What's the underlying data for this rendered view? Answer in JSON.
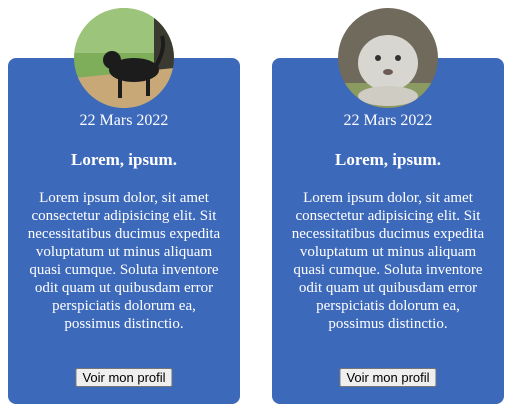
{
  "cards": [
    {
      "date": "22 Mars 2022",
      "title": "Lorem, ipsum.",
      "text": "Lorem ipsum dolor, sit amet consectetur adipisicing elit. Sit necessitatibus ducimus expedita voluptatum ut minus aliquam quasi cumque. Soluta inventore odit quam ut quibusdam error perspiciatis dolorum ea, possimus distinctio.",
      "button": "Voir mon profil",
      "image": "cat-photo"
    },
    {
      "date": "22 Mars 2022",
      "title": "Lorem, ipsum.",
      "text": "Lorem ipsum dolor, sit amet consectetur adipisicing elit. Sit necessitatibus ducimus expedita voluptatum ut minus aliquam quasi cumque. Soluta inventore odit quam ut quibusdam error perspiciatis dolorum ea, possimus distinctio.",
      "button": "Voir mon profil",
      "image": "snow-leopard-photo"
    }
  ],
  "colors": {
    "card": "#3d69ba"
  }
}
